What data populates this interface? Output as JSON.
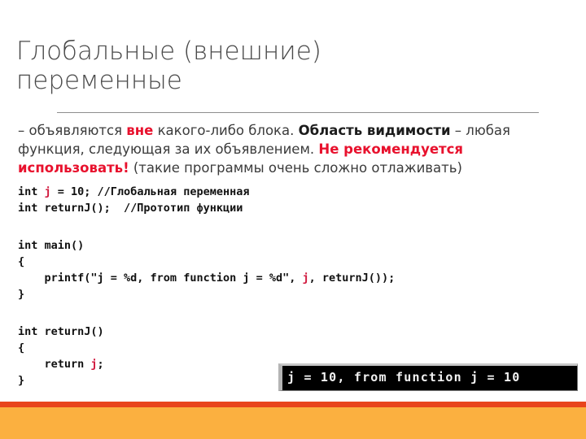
{
  "slide": {
    "title_line_1": "Глобальные (внешние)",
    "title_line_2": "переменные",
    "body": {
      "seg_1": "– объявляются ",
      "seg_2_red_bold": "вне",
      "seg_3": " какого-либо блока. ",
      "seg_4_black_bold": "Область видимости",
      "seg_5": " – любая функция, следующая за их объявлением. ",
      "seg_6_red_bold": "Не рекомендуется использовать!",
      "seg_7": " (такие программы очень сложно отлаживать)"
    },
    "code_block_1": {
      "line_1_pre": "int ",
      "line_1_var": "j",
      "line_1_post": " = 10; //Глобальная переменная",
      "line_2": "int returnJ();  //Прототип функции"
    },
    "code_block_2": {
      "line_1": "int main()",
      "line_2": "{",
      "line_3_pre": "    printf(\"j = %d, from function j = %d\", ",
      "line_3_var": "j",
      "line_3_post": ", returnJ());",
      "line_4": "}"
    },
    "code_block_3": {
      "line_1": "int returnJ()",
      "line_2": "{",
      "line_3_pre": "    return ",
      "line_3_var": "j",
      "line_3_post": ";",
      "line_4": "}"
    },
    "console_output": "j = 10, from function j = 10",
    "colors": {
      "accent_red": "#e8112d",
      "code_red": "#d1193e",
      "band_red": "#e8441c",
      "band_orange": "#fbb040",
      "title_gray": "#4a4a4a",
      "rule_gray": "#8d8d8d",
      "console_bg": "#000000",
      "console_text": "#f2f2f2"
    }
  }
}
